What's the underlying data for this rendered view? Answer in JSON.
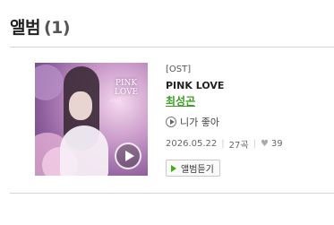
{
  "section": {
    "title": "앨범",
    "count": "(1)"
  },
  "album": {
    "cover_title_art": "PINK LOVE",
    "cover_subtitle_art": "OST",
    "type": "[OST]",
    "name": "PINK LOVE",
    "artist": "최성곤",
    "track": "니가 좋아",
    "date": "2026.05.22",
    "track_count": "27곡",
    "likes": "39"
  },
  "buttons": {
    "listen_label": "앨범듣기"
  },
  "icons": {
    "track_play": "play-circle-icon",
    "like": "heart-icon",
    "listen": "play-triangle-icon"
  },
  "colors": {
    "artist_link": "#3a9e22",
    "listen_icon": "#3cb016"
  }
}
